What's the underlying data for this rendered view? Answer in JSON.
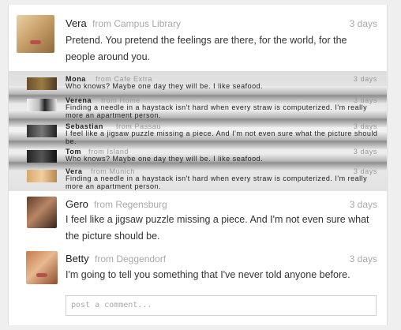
{
  "posts": [
    {
      "name": "Vera",
      "from": "from Campus Library",
      "time": "3 days",
      "text": "Pretend. You pretend the feelings are there, for the world, for the people around you."
    },
    {
      "name": "Gero",
      "from": "from Regensburg",
      "time": "3 days",
      "text": "I feel like a jigsaw puzzle missing a piece. And I'm not even sure what the picture should be."
    },
    {
      "name": "Betty",
      "from": "from Deggendorf",
      "time": "3 days",
      "text": "I'm going to tell you something that I've never told anyone before."
    }
  ],
  "compressed": [
    {
      "name": "Mona",
      "from": "from Cafe Extra",
      "time": "3 days",
      "text": "Who knows? Maybe one day they will be. I like seafood."
    },
    {
      "name": "Verena",
      "from": "from Home",
      "time": "3 days",
      "text": "Finding a needle in a haystack isn't hard when every straw is computerized. I'm really more an apartment person."
    },
    {
      "name": "Sebastian",
      "from": "from Passau",
      "time": "3 days",
      "text": "I feel like a jigsaw puzzle missing a piece. And I'm not even sure what the picture should be."
    },
    {
      "name": "Tom",
      "from": "from Island",
      "time": "3 days",
      "text": "Who knows? Maybe one day they will be. I like seafood."
    },
    {
      "name": "Vera",
      "from": "from Munich",
      "time": "3 days",
      "text": "Finding a needle in a haystack isn't hard when every straw is computerized. I'm really more an apartment person."
    }
  ],
  "comment": {
    "placeholder": "post a comment..."
  }
}
